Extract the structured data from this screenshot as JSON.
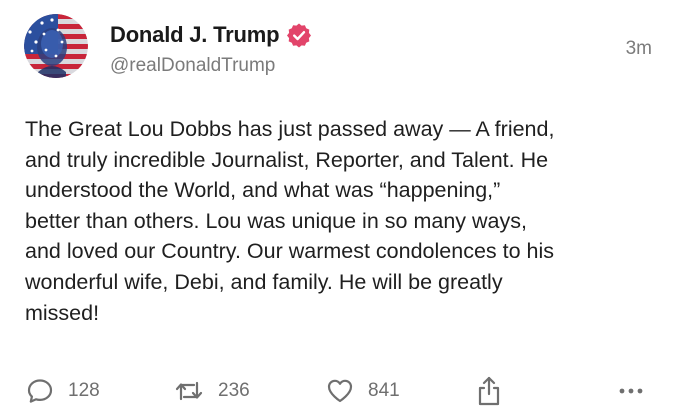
{
  "post": {
    "author": {
      "display_name": "Donald J. Trump",
      "handle": "@realDonaldTrump",
      "verified": true,
      "verified_badge_color": "#e2446a"
    },
    "timestamp": "3m",
    "content_lines": [
      "The Great Lou Dobbs has just passed away — A friend,",
      "and truly incredible Journalist, Reporter, and Talent. He",
      "understood the World, and what was “happening,”",
      "better than others. Lou was unique in so many ways,",
      "and loved our Country. Our warmest condolences to his",
      "wonderful wife, Debi, and family. He will be greatly",
      "missed!"
    ],
    "actions": {
      "reply": {
        "icon": "speech-bubble-icon",
        "count": "128"
      },
      "repost": {
        "icon": "repost-arrows-icon",
        "count": "236"
      },
      "like": {
        "icon": "heart-icon",
        "count": "841"
      },
      "share": {
        "icon": "share-upload-icon"
      },
      "more": {
        "icon": "more-dots-icon"
      }
    }
  }
}
